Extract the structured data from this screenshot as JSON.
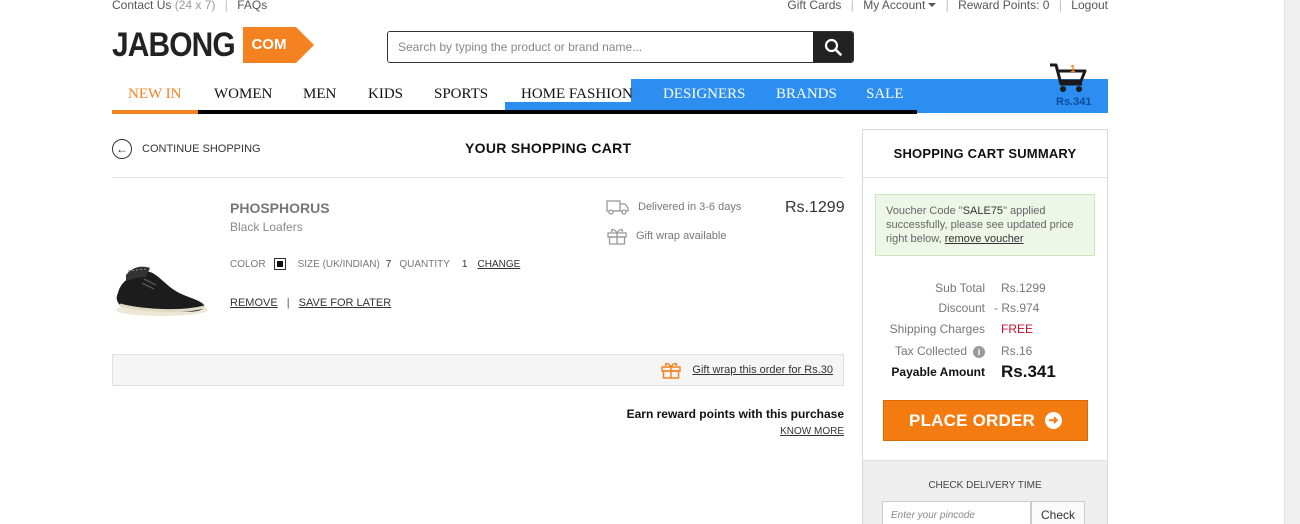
{
  "top_bar": {
    "contact_label": "Contact Us",
    "contact_hours": "(24 x 7)",
    "faqs": "FAQs",
    "gift_cards": "Gift Cards",
    "my_account": "My Account",
    "reward_points": "Reward Points: 0",
    "logout": "Logout"
  },
  "logo": {
    "word": "JABONG",
    "suffix": "COM"
  },
  "search": {
    "placeholder": "Search by typing the product or brand name..."
  },
  "nav": {
    "items": [
      "NEW IN",
      "WOMEN",
      "MEN",
      "KIDS",
      "SPORTS",
      "HOME FASHION",
      "DESIGNERS",
      "BRANDS",
      "SALE"
    ],
    "active": "NEW IN"
  },
  "mini_cart": {
    "count": "1",
    "amount": "Rs.341"
  },
  "cart": {
    "continue_label": "CONTINUE SHOPPING",
    "title": "YOUR SHOPPING CART",
    "item": {
      "brand": "PHOSPHORUS",
      "name": "Black Loafers",
      "color_label": "COLOR",
      "color_value": "#111111",
      "size_label": "SIZE (UK/INDIAN)",
      "size_value": "7",
      "qty_label": "QUANTITY",
      "qty_value": "1",
      "change": "CHANGE",
      "remove": "REMOVE",
      "save_later": "SAVE FOR LATER",
      "delivery": "Delivered in 3-6 days",
      "gift_wrap": "Gift wrap available",
      "price": "Rs.1299"
    },
    "gift_order": "Gift wrap this order for Rs.30",
    "earn": "Earn reward points with this purchase",
    "know_more": "KNOW MORE"
  },
  "summary": {
    "title": "SHOPPING CART SUMMARY",
    "voucher": {
      "prefix": "Voucher Code \"",
      "code": "SALE75",
      "suffix": "\" applied successfully, please see updated price right below,",
      "remove": "remove voucher"
    },
    "rows": [
      {
        "label": "Sub Total",
        "value": "Rs.1299"
      },
      {
        "label": "Discount",
        "value": "- Rs.974"
      },
      {
        "label": "Shipping Charges",
        "value": "FREE"
      },
      {
        "label": "Tax Collected",
        "value": "Rs.16"
      },
      {
        "label": "Payable Amount",
        "value": "Rs.341"
      }
    ],
    "place_order": "PLACE ORDER",
    "delivery_title": "CHECK DELIVERY TIME",
    "pincode_placeholder": "Enter your pincode",
    "check": "Check"
  },
  "colors": {
    "brand_orange": "#f58220",
    "nav_blue": "#2b8ef0",
    "free_red": "#c8102e"
  }
}
